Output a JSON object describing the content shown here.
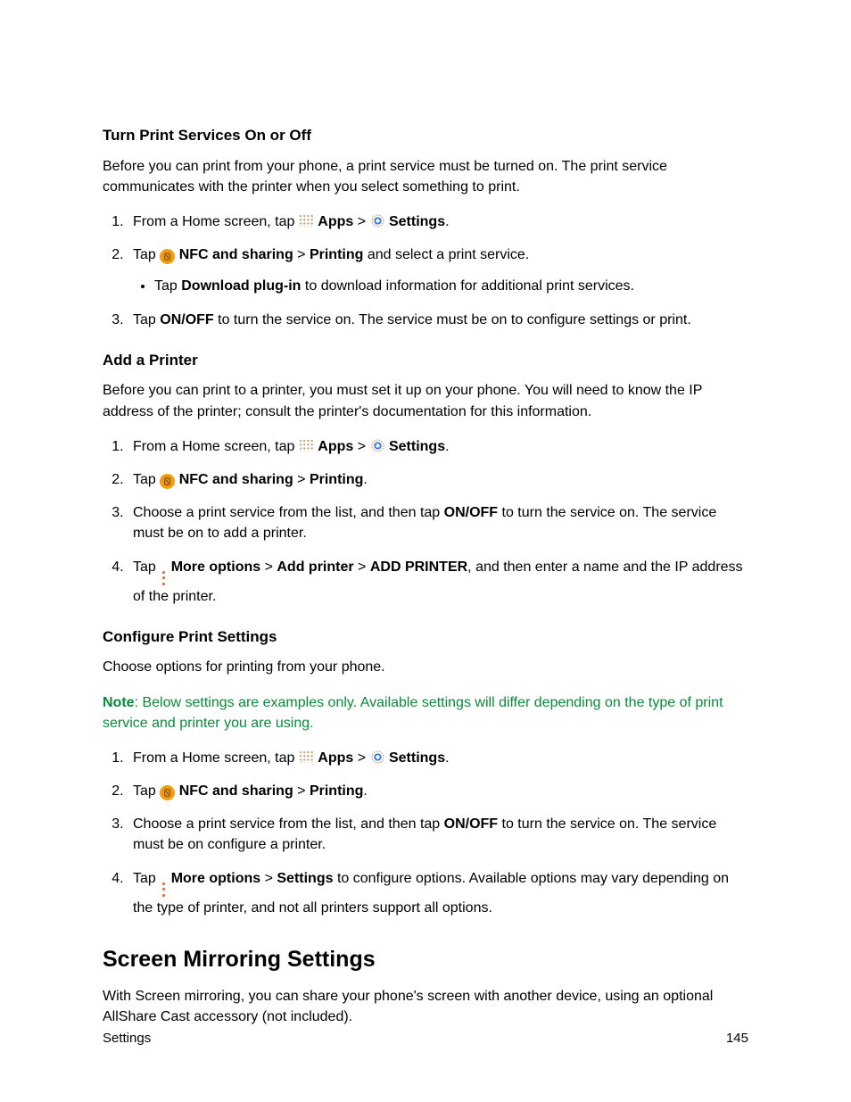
{
  "s1": {
    "heading": "Turn Print Services On or Off",
    "intro": "Before you can print from your phone, a print service must be turned on. The print service communicates with the printer when you select something to print.",
    "step1_a": "From a Home screen, tap ",
    "apps": "Apps",
    "gt": " > ",
    "settings": "Settings",
    "period": ".",
    "step2_a": "Tap ",
    "nfc": "NFC and sharing",
    "printing": "Printing",
    "step2_b": " and select a print service.",
    "step2_sub_a": "Tap ",
    "download": "Download plug-in",
    "step2_sub_b": " to download information for additional print services.",
    "step3_a": "Tap ",
    "onoff": "ON/OFF",
    "step3_b": " to turn the service on. The service must be on to configure settings or print."
  },
  "s2": {
    "heading": "Add a Printer",
    "intro": "Before you can print to a printer, you must set it up on your phone. You will need to know the IP address of the printer; consult the printer's documentation for this information.",
    "step3_a": "Choose a print service from the list, and then tap ",
    "step3_b": " to turn the service on. The service must be on to add a printer.",
    "step4_a": "Tap ",
    "more": "More options",
    "addp": "Add printer",
    "addP2": "ADD PRINTER",
    "step4_b": ", and then enter a name and the IP address of the printer."
  },
  "s3": {
    "heading": "Configure Print Settings",
    "intro": "Choose options for printing from your phone.",
    "note_b": "Note",
    "note_rest": ": Below settings are examples only. Available settings will differ depending on the type of print service and printer you are using.",
    "step3_b": " to turn the service on. The service must be on configure a printer.",
    "step4_settings": "Settings",
    "step4_b": " to configure options. Available options may vary depending on the type of printer, and not all printers support all options."
  },
  "s4": {
    "heading": "Screen Mirroring Settings",
    "intro": "With Screen mirroring, you can share your phone's screen with another device, using an optional AllShare Cast accessory (not included)."
  },
  "footer": {
    "left": "Settings",
    "right": "145"
  }
}
